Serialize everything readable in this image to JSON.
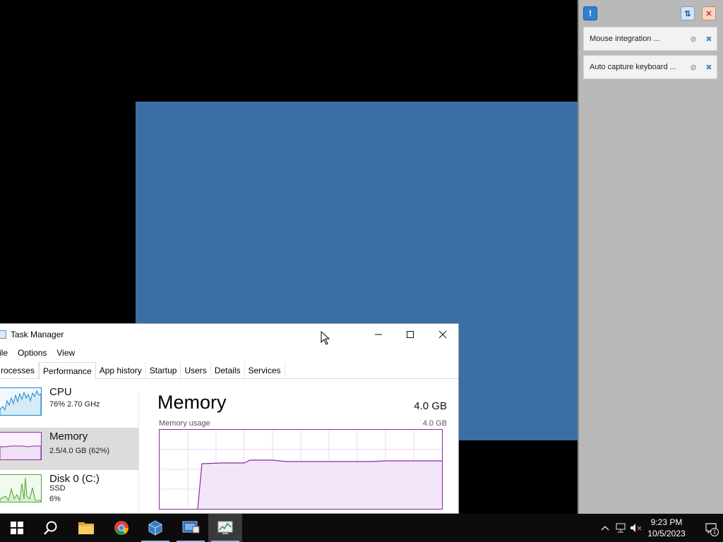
{
  "notification_panel": {
    "notifications": [
      {
        "text": "Mouse integration ..."
      },
      {
        "text": "Auto capture keyboard ..."
      }
    ]
  },
  "task_manager": {
    "title": "Task Manager",
    "menu": [
      "ile",
      "Options",
      "View"
    ],
    "tabs": [
      "rocesses",
      "Performance",
      "App history",
      "Startup",
      "Users",
      "Details",
      "Services"
    ],
    "active_tab": "Performance",
    "sidebar": [
      {
        "name": "CPU",
        "line1": "76%  2.70 GHz"
      },
      {
        "name": "Memory",
        "line1": "2.5/4.0 GB (62%)"
      },
      {
        "name": "Disk 0 (C:)",
        "line1": "SSD",
        "line2": "6%"
      }
    ],
    "main": {
      "heading": "Memory",
      "total": "4.0 GB",
      "graph_label": "Memory usage",
      "graph_max": "4.0 GB"
    }
  },
  "taskbar": {
    "clock_time": "9:23 PM",
    "clock_date": "10/5/2023",
    "notification_count": "1"
  },
  "colors": {
    "vm_blue": "#3b6ea5",
    "memory_purple": "#8b2ba8",
    "cpu_blue": "#1a87c8",
    "disk_green": "#4ca82b"
  }
}
